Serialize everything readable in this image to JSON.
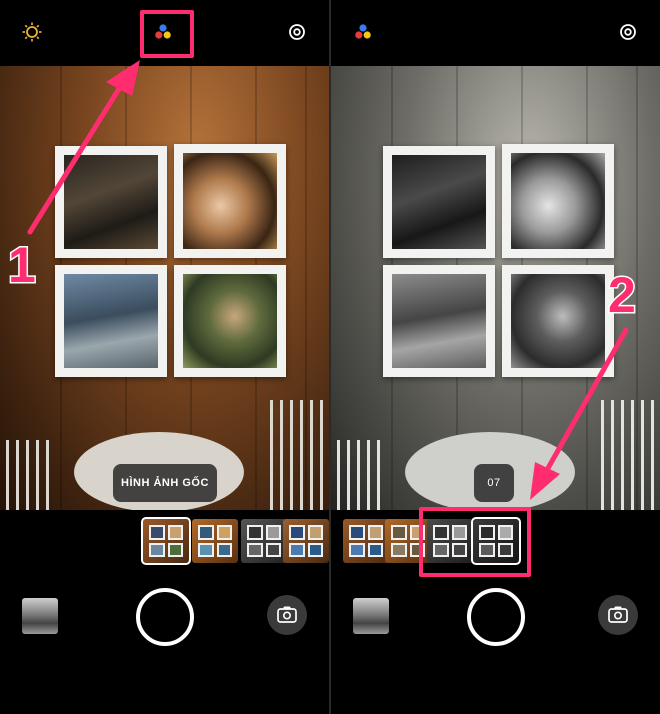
{
  "left_screen": {
    "filter_label": "HÌNH ẢNH GỐC",
    "filters": [
      "original",
      "warm",
      "mono",
      "cool"
    ],
    "selected_filter_index": 0
  },
  "right_screen": {
    "filter_label": "07",
    "filters": [
      "cool",
      "warm",
      "mono",
      "mono"
    ],
    "selected_filter_index": 3
  },
  "icons": {
    "exposure": "sun-icon",
    "filters": "filter-dots-icon",
    "settings": "settings-icon",
    "shutter": "shutter-button",
    "flip": "flip-camera-icon"
  },
  "annotations": {
    "step1": "1",
    "step2": "2",
    "accent": "#ff2d6f"
  }
}
